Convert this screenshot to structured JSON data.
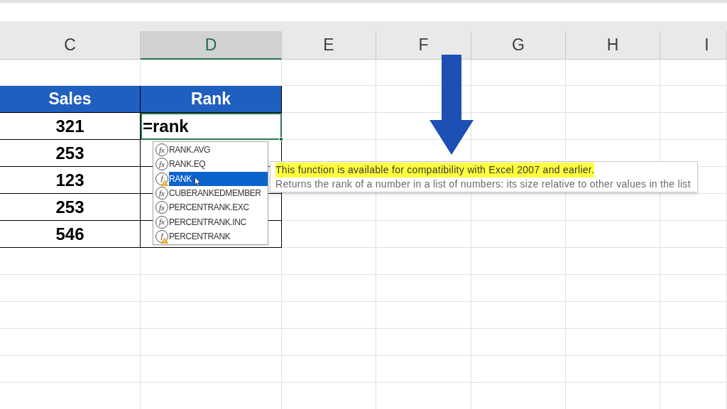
{
  "column_headers": [
    {
      "label": "C",
      "selected": false
    },
    {
      "label": "D",
      "selected": true
    },
    {
      "label": "E",
      "selected": false
    },
    {
      "label": "F",
      "selected": false
    },
    {
      "label": "G",
      "selected": false
    },
    {
      "label": "H",
      "selected": false
    },
    {
      "label": "I",
      "selected": false
    }
  ],
  "table": {
    "columns": [
      "Sales",
      "Rank"
    ],
    "rows": [
      {
        "sales": "321",
        "rank": "=rank",
        "editing": true
      },
      {
        "sales": "253",
        "editing": false
      },
      {
        "sales": "123",
        "editing": false
      },
      {
        "sales": "253",
        "editing": false
      },
      {
        "sales": "546",
        "editing": false
      }
    ]
  },
  "autocomplete": {
    "items": [
      {
        "icon": "fx",
        "label": "RANK.AVG",
        "kind": "function",
        "selected": false
      },
      {
        "icon": "fx",
        "label": "RANK.EQ",
        "kind": "function",
        "selected": false
      },
      {
        "icon": "f",
        "label": "RANK",
        "kind": "compatibility",
        "selected": true
      },
      {
        "icon": "fx",
        "label": "CUBERANKEDMEMBER",
        "kind": "function",
        "selected": false
      },
      {
        "icon": "fx",
        "label": "PERCENTRANK.EXC",
        "kind": "function",
        "selected": false
      },
      {
        "icon": "fx",
        "label": "PERCENTRANK.INC",
        "kind": "function",
        "selected": false
      },
      {
        "icon": "f",
        "label": "PERCENTRANK",
        "kind": "compatibility",
        "selected": false
      }
    ]
  },
  "tooltip": {
    "lines": [
      {
        "text": "This function is available for compatibility with Excel 2007 and earlier.",
        "highlighted": true
      },
      {
        "text": "Returns the rank of a number in a list of numbers: its size relative to other values in the list",
        "highlighted": false
      }
    ]
  }
}
